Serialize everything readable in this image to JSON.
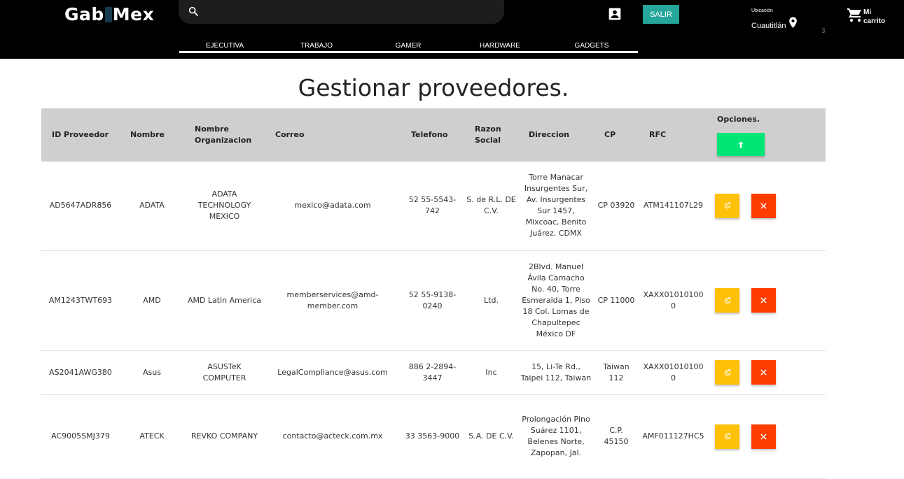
{
  "header": {
    "logo_left": "Gab",
    "logo_right": "Mex",
    "search_placeholder": "",
    "exit_label": "SALIR",
    "location_label": "Ubicación",
    "location_value": "Cuautitlán",
    "cart_count": "3",
    "cart_label": "Mi carrito"
  },
  "nav": [
    "EJECUTIVA",
    "TRABAJO",
    "GAMER",
    "HARDWARE",
    "GADGETS"
  ],
  "page_title": "Gestionar proveedores.",
  "table": {
    "columns": [
      "ID Proveedor",
      "Nombre",
      "Nombre Organizacion",
      "Correo",
      "Telefono",
      "Razon Social",
      "Direccion",
      "CP",
      "RFC",
      "Opciones."
    ],
    "rows": [
      [
        "AD5647ADR856",
        "ADATA",
        "ADATA TECHNOLOGY MEXICO",
        "mexico@adata.com",
        "52 55-5543-742",
        "S. de R.L. DE C.V.",
        "Torre Manacar Insurgentes Sur, Av. Insurgentes Sur 1457, Mixcoac, Benito Juárez, CDMX",
        "CP 03920",
        "ATM141107L29"
      ],
      [
        "AM1243TWT693",
        "AMD",
        "AMD Latin America",
        "memberservices@amd-member.com",
        "52 55-9138-0240",
        "Ltd.",
        "2Blvd. Manuel Ávila Camacho No. 40, Torre Esmeralda 1, Piso 18 Col. Lomas de Chapultepec México DF",
        "CP 11000",
        "XAXX010101000"
      ],
      [
        "AS2041AWG380",
        "Asus",
        "ASUSTeK COMPUTER",
        "LegalCompliance@asus.com",
        "886 2-2894-3447",
        "Inc",
        "15, Li-Te Rd., Taipei 112, Taiwan",
        "Taiwan 112",
        "XAXX010101000"
      ],
      [
        "AC9005SMJ379",
        "ATECK",
        "REVKO COMPANY",
        "contacto@acteck.com.mx",
        "33 3563-9000",
        "S.A. DE C.V.",
        "Prolongación Pino Suárez 1101, Belenes Norte, Zapopan, Jal.",
        "C.P. 45150",
        "AMF011127HC5"
      ]
    ]
  },
  "colors": {
    "header_bg": "#000000",
    "exit_button": "#26a69a",
    "add_button": "#00e676",
    "edit_button": "#ffc107",
    "delete_button": "#ff3d00",
    "table_header_bg": "#cfcfcf"
  },
  "icons": {
    "search": "search-icon",
    "account": "account-box-icon",
    "location": "location-pin-icon",
    "cart": "shopping-cart-icon",
    "upload": "arrow-up-icon",
    "edit": "edit-icon",
    "delete": "close-icon"
  }
}
